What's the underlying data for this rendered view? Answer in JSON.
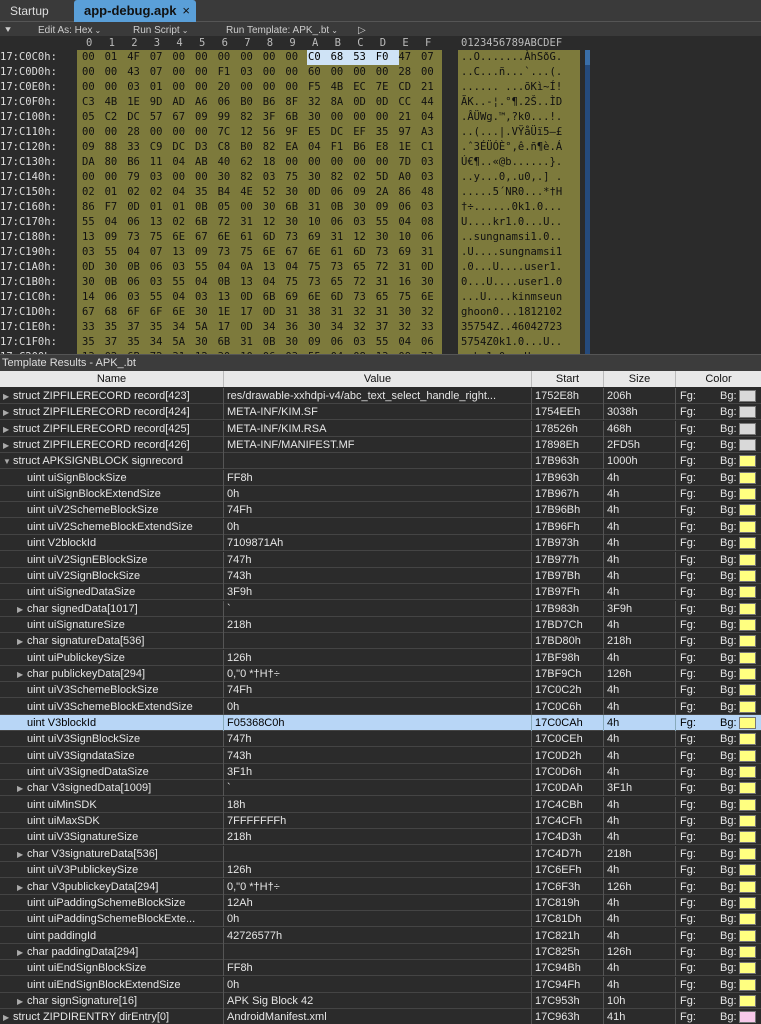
{
  "tabs": {
    "startup": "Startup",
    "active": "app-debug.apk",
    "close": "×"
  },
  "toolbar": {
    "edit_as": "Edit As: Hex",
    "run_script": "Run Script",
    "run_template": "Run Template: APK_.bt",
    "play": "▷",
    "pin": "⯆"
  },
  "hex": {
    "col_header": [
      "0",
      "1",
      "2",
      "3",
      "4",
      "5",
      "6",
      "7",
      "8",
      "9",
      "A",
      "B",
      "C",
      "D",
      "E",
      "F"
    ],
    "ascii_header": "0123456789ABCDEF",
    "rows": [
      {
        "addr": "17:C0C0h:",
        "bytes": [
          "00",
          "01",
          "4F",
          "07",
          "00",
          "00",
          "00",
          "00",
          "00",
          "00",
          "C0",
          "68",
          "53",
          "F0",
          "47",
          "07"
        ],
        "ascii": "..O.......ÀhSðG."
      },
      {
        "addr": "17:C0D0h:",
        "bytes": [
          "00",
          "00",
          "43",
          "07",
          "00",
          "00",
          "F1",
          "03",
          "00",
          "00",
          "60",
          "00",
          "00",
          "00",
          "28",
          "00"
        ],
        "ascii": "..C...ñ...`...(."
      },
      {
        "addr": "17:C0E0h:",
        "bytes": [
          "00",
          "00",
          "03",
          "01",
          "00",
          "00",
          "20",
          "00",
          "00",
          "00",
          "F5",
          "4B",
          "EC",
          "7E",
          "CD",
          "21"
        ],
        "ascii": "...... ...õKì~Í!"
      },
      {
        "addr": "17:C0F0h:",
        "bytes": [
          "C3",
          "4B",
          "1E",
          "9D",
          "AD",
          "A6",
          "06",
          "B0",
          "B6",
          "8F",
          "32",
          "8A",
          "0D",
          "0D",
          "CC",
          "44"
        ],
        "ascii": "ÃK..-¦.°¶.2Š..ÌD"
      },
      {
        "addr": "17:C100h:",
        "bytes": [
          "05",
          "C2",
          "DC",
          "57",
          "67",
          "09",
          "99",
          "82",
          "3F",
          "6B",
          "30",
          "00",
          "00",
          "00",
          "21",
          "04"
        ],
        "ascii": ".ÂÜWg.™‚?k0...!."
      },
      {
        "addr": "17:C110h:",
        "bytes": [
          "00",
          "00",
          "28",
          "00",
          "00",
          "00",
          "7C",
          "12",
          "56",
          "9F",
          "E5",
          "DC",
          "EF",
          "35",
          "97",
          "A3"
        ],
        "ascii": "..(...|.VŸåÜï5—£"
      },
      {
        "addr": "17:C120h:",
        "bytes": [
          "09",
          "88",
          "33",
          "C9",
          "DC",
          "D3",
          "C8",
          "B0",
          "82",
          "EA",
          "04",
          "F1",
          "B6",
          "E8",
          "1E",
          "C1"
        ],
        "ascii": ".ˆ3ÉÜÓÈ°‚ê.ñ¶è.Á"
      },
      {
        "addr": "17:C130h:",
        "bytes": [
          "DA",
          "80",
          "B6",
          "11",
          "04",
          "AB",
          "40",
          "62",
          "18",
          "00",
          "00",
          "00",
          "00",
          "00",
          "7D",
          "03"
        ],
        "ascii": "Ú€¶..«@b......}."
      },
      {
        "addr": "17:C140h:",
        "bytes": [
          "00",
          "00",
          "79",
          "03",
          "00",
          "00",
          "30",
          "82",
          "03",
          "75",
          "30",
          "82",
          "02",
          "5D",
          "A0",
          "03"
        ],
        "ascii": "..y...0‚.u0‚.] ."
      },
      {
        "addr": "17:C150h:",
        "bytes": [
          "02",
          "01",
          "02",
          "02",
          "04",
          "35",
          "B4",
          "4E",
          "52",
          "30",
          "0D",
          "06",
          "09",
          "2A",
          "86",
          "48"
        ],
        "ascii": ".....5´NR0...*†H"
      },
      {
        "addr": "17:C160h:",
        "bytes": [
          "86",
          "F7",
          "0D",
          "01",
          "01",
          "0B",
          "05",
          "00",
          "30",
          "6B",
          "31",
          "0B",
          "30",
          "09",
          "06",
          "03"
        ],
        "ascii": "†÷......0k1.0..."
      },
      {
        "addr": "17:C170h:",
        "bytes": [
          "55",
          "04",
          "06",
          "13",
          "02",
          "6B",
          "72",
          "31",
          "12",
          "30",
          "10",
          "06",
          "03",
          "55",
          "04",
          "08"
        ],
        "ascii": "U....kr1.0...U.."
      },
      {
        "addr": "17:C180h:",
        "bytes": [
          "13",
          "09",
          "73",
          "75",
          "6E",
          "67",
          "6E",
          "61",
          "6D",
          "73",
          "69",
          "31",
          "12",
          "30",
          "10",
          "06"
        ],
        "ascii": "..sungnamsi1.0.."
      },
      {
        "addr": "17:C190h:",
        "bytes": [
          "03",
          "55",
          "04",
          "07",
          "13",
          "09",
          "73",
          "75",
          "6E",
          "67",
          "6E",
          "61",
          "6D",
          "73",
          "69",
          "31"
        ],
        "ascii": ".U....sungnamsi1"
      },
      {
        "addr": "17:C1A0h:",
        "bytes": [
          "0D",
          "30",
          "0B",
          "06",
          "03",
          "55",
          "04",
          "0A",
          "13",
          "04",
          "75",
          "73",
          "65",
          "72",
          "31",
          "0D"
        ],
        "ascii": ".0...U....user1."
      },
      {
        "addr": "17:C1B0h:",
        "bytes": [
          "30",
          "0B",
          "06",
          "03",
          "55",
          "04",
          "0B",
          "13",
          "04",
          "75",
          "73",
          "65",
          "72",
          "31",
          "16",
          "30"
        ],
        "ascii": "0...U....user1.0"
      },
      {
        "addr": "17:C1C0h:",
        "bytes": [
          "14",
          "06",
          "03",
          "55",
          "04",
          "03",
          "13",
          "0D",
          "6B",
          "69",
          "6E",
          "6D",
          "73",
          "65",
          "75",
          "6E"
        ],
        "ascii": "...U....kinmseun"
      },
      {
        "addr": "17:C1D0h:",
        "bytes": [
          "67",
          "68",
          "6F",
          "6F",
          "6E",
          "30",
          "1E",
          "17",
          "0D",
          "31",
          "38",
          "31",
          "32",
          "31",
          "30",
          "32"
        ],
        "ascii": "ghoon0...1812102"
      },
      {
        "addr": "17:C1E0h:",
        "bytes": [
          "33",
          "35",
          "37",
          "35",
          "34",
          "5A",
          "17",
          "0D",
          "34",
          "36",
          "30",
          "34",
          "32",
          "37",
          "32",
          "33"
        ],
        "ascii": "35754Z..46042723"
      },
      {
        "addr": "17:C1F0h:",
        "bytes": [
          "35",
          "37",
          "35",
          "34",
          "5A",
          "30",
          "6B",
          "31",
          "0B",
          "30",
          "09",
          "06",
          "03",
          "55",
          "04",
          "06"
        ],
        "ascii": "5754Z0k1.0...U.."
      },
      {
        "addr": "17:C200h:",
        "bytes": [
          "13",
          "02",
          "6B",
          "72",
          "31",
          "12",
          "30",
          "10",
          "06",
          "03",
          "55",
          "04",
          "08",
          "13",
          "09",
          "73"
        ],
        "ascii": "..kr1.0...U....s"
      }
    ]
  },
  "template": {
    "title": "Template Results - APK_.bt",
    "columns": [
      "Name",
      "Value",
      "Start",
      "Size",
      "Color"
    ],
    "fg_label": "Fg:",
    "bg_label": "Bg:",
    "rows": [
      {
        "tri": "▶",
        "indent": 0,
        "name": "struct ZIPFILERECORD record[423]",
        "value": "res/drawable-xxhdpi-v4/abc_text_select_handle_right...",
        "start": "1752E8h",
        "size": "206h",
        "bg": "gray"
      },
      {
        "tri": "▶",
        "indent": 0,
        "name": "struct ZIPFILERECORD record[424]",
        "value": "META-INF/KIM.SF",
        "start": "1754EEh",
        "size": "3038h",
        "bg": "gray"
      },
      {
        "tri": "▶",
        "indent": 0,
        "name": "struct ZIPFILERECORD record[425]",
        "value": "META-INF/KIM.RSA",
        "start": "178526h",
        "size": "468h",
        "bg": "gray"
      },
      {
        "tri": "▶",
        "indent": 0,
        "name": "struct ZIPFILERECORD record[426]",
        "value": "META-INF/MANIFEST.MF",
        "start": "17898Eh",
        "size": "2FD5h",
        "bg": "gray"
      },
      {
        "tri": "▼",
        "indent": 0,
        "name": "struct APKSIGNBLOCK signrecord",
        "value": "",
        "start": "17B963h",
        "size": "1000h",
        "bg": "yellow"
      },
      {
        "tri": "",
        "indent": 1,
        "name": "uint uiSignBlockSize",
        "value": "FF8h",
        "start": "17B963h",
        "size": "4h",
        "bg": "yellow"
      },
      {
        "tri": "",
        "indent": 1,
        "name": "uint uiSignBlockExtendSize",
        "value": "0h",
        "start": "17B967h",
        "size": "4h",
        "bg": "yellow"
      },
      {
        "tri": "",
        "indent": 1,
        "name": "uint uiV2SchemeBlockSize",
        "value": "74Fh",
        "start": "17B96Bh",
        "size": "4h",
        "bg": "yellow"
      },
      {
        "tri": "",
        "indent": 1,
        "name": "uint uiV2SchemeBlockExtendSize",
        "value": "0h",
        "start": "17B96Fh",
        "size": "4h",
        "bg": "yellow"
      },
      {
        "tri": "",
        "indent": 1,
        "name": "uint V2blockId",
        "value": "7109871Ah",
        "start": "17B973h",
        "size": "4h",
        "bg": "yellow"
      },
      {
        "tri": "",
        "indent": 1,
        "name": "uint uiV2SignEBlockSize",
        "value": "747h",
        "start": "17B977h",
        "size": "4h",
        "bg": "yellow"
      },
      {
        "tri": "",
        "indent": 1,
        "name": "uint uiV2SignBlockSize",
        "value": "743h",
        "start": "17B97Bh",
        "size": "4h",
        "bg": "yellow"
      },
      {
        "tri": "",
        "indent": 1,
        "name": "uint uiSignedDataSize",
        "value": "3F9h",
        "start": "17B97Fh",
        "size": "4h",
        "bg": "yellow"
      },
      {
        "tri": "▶",
        "indent": 1,
        "name": "char signedData[1017]",
        "value": "`",
        "start": "17B983h",
        "size": "3F9h",
        "bg": "yellow"
      },
      {
        "tri": "",
        "indent": 1,
        "name": "uint uiSignatureSize",
        "value": "218h",
        "start": "17BD7Ch",
        "size": "4h",
        "bg": "yellow"
      },
      {
        "tri": "▶",
        "indent": 1,
        "name": "char signatureData[536]",
        "value": "",
        "start": "17BD80h",
        "size": "218h",
        "bg": "yellow"
      },
      {
        "tri": "",
        "indent": 1,
        "name": "uint uiPublickeySize",
        "value": "126h",
        "start": "17BF98h",
        "size": "4h",
        "bg": "yellow"
      },
      {
        "tri": "▶",
        "indent": 1,
        "name": "char publickeyData[294]",
        "value": "0,\"0  *†H†÷",
        "start": "17BF9Ch",
        "size": "126h",
        "bg": "yellow"
      },
      {
        "tri": "",
        "indent": 1,
        "name": "uint uiV3SchemeBlockSize",
        "value": "74Fh",
        "start": "17C0C2h",
        "size": "4h",
        "bg": "yellow"
      },
      {
        "tri": "",
        "indent": 1,
        "name": "uint uiV3SchemeBlockExtendSize",
        "value": "0h",
        "start": "17C0C6h",
        "size": "4h",
        "bg": "yellow"
      },
      {
        "tri": "",
        "indent": 1,
        "name": "uint V3blockId",
        "value": "F05368C0h",
        "start": "17C0CAh",
        "size": "4h",
        "bg": "yellow",
        "selected": true
      },
      {
        "tri": "",
        "indent": 1,
        "name": "uint uiV3SignBlockSize",
        "value": "747h",
        "start": "17C0CEh",
        "size": "4h",
        "bg": "yellow"
      },
      {
        "tri": "",
        "indent": 1,
        "name": "uint uiV3SigndataSize",
        "value": "743h",
        "start": "17C0D2h",
        "size": "4h",
        "bg": "yellow"
      },
      {
        "tri": "",
        "indent": 1,
        "name": "uint uiV3SignedDataSize",
        "value": "3F1h",
        "start": "17C0D6h",
        "size": "4h",
        "bg": "yellow"
      },
      {
        "tri": "▶",
        "indent": 1,
        "name": "char V3signedData[1009]",
        "value": "`",
        "start": "17C0DAh",
        "size": "3F1h",
        "bg": "yellow"
      },
      {
        "tri": "",
        "indent": 1,
        "name": "uint uiMinSDK",
        "value": "18h",
        "start": "17C4CBh",
        "size": "4h",
        "bg": "yellow"
      },
      {
        "tri": "",
        "indent": 1,
        "name": "uint uiMaxSDK",
        "value": "7FFFFFFFh",
        "start": "17C4CFh",
        "size": "4h",
        "bg": "yellow"
      },
      {
        "tri": "",
        "indent": 1,
        "name": "uint uiV3SignatureSize",
        "value": "218h",
        "start": "17C4D3h",
        "size": "4h",
        "bg": "yellow"
      },
      {
        "tri": "▶",
        "indent": 1,
        "name": "char V3signatureData[536]",
        "value": "",
        "start": "17C4D7h",
        "size": "218h",
        "bg": "yellow"
      },
      {
        "tri": "",
        "indent": 1,
        "name": "uint uiV3PublickeySize",
        "value": "126h",
        "start": "17C6EFh",
        "size": "4h",
        "bg": "yellow"
      },
      {
        "tri": "▶",
        "indent": 1,
        "name": "char V3publickeyData[294]",
        "value": "0,\"0  *†H†÷",
        "start": "17C6F3h",
        "size": "126h",
        "bg": "yellow"
      },
      {
        "tri": "",
        "indent": 1,
        "name": "uint uiPaddingSchemeBlockSize",
        "value": "12Ah",
        "start": "17C819h",
        "size": "4h",
        "bg": "yellow"
      },
      {
        "tri": "",
        "indent": 1,
        "name": "uint uiPaddingSchemeBlockExte...",
        "value": "0h",
        "start": "17C81Dh",
        "size": "4h",
        "bg": "yellow"
      },
      {
        "tri": "",
        "indent": 1,
        "name": "uint paddingId",
        "value": "42726577h",
        "start": "17C821h",
        "size": "4h",
        "bg": "yellow"
      },
      {
        "tri": "▶",
        "indent": 1,
        "name": "char paddingData[294]",
        "value": "",
        "start": "17C825h",
        "size": "126h",
        "bg": "yellow"
      },
      {
        "tri": "",
        "indent": 1,
        "name": "uint uiEndSignBlockSize",
        "value": "FF8h",
        "start": "17C94Bh",
        "size": "4h",
        "bg": "yellow"
      },
      {
        "tri": "",
        "indent": 1,
        "name": "uint uiEndSignBlockExtendSize",
        "value": "0h",
        "start": "17C94Fh",
        "size": "4h",
        "bg": "yellow"
      },
      {
        "tri": "▶",
        "indent": 1,
        "name": "char signSignature[16]",
        "value": "APK Sig Block 42",
        "start": "17C953h",
        "size": "10h",
        "bg": "yellow"
      },
      {
        "tri": "▶",
        "indent": 0,
        "name": "struct ZIPDIRENTRY dirEntry[0]",
        "value": "AndroidManifest.xml",
        "start": "17C963h",
        "size": "41h",
        "bg": "pink"
      }
    ]
  }
}
